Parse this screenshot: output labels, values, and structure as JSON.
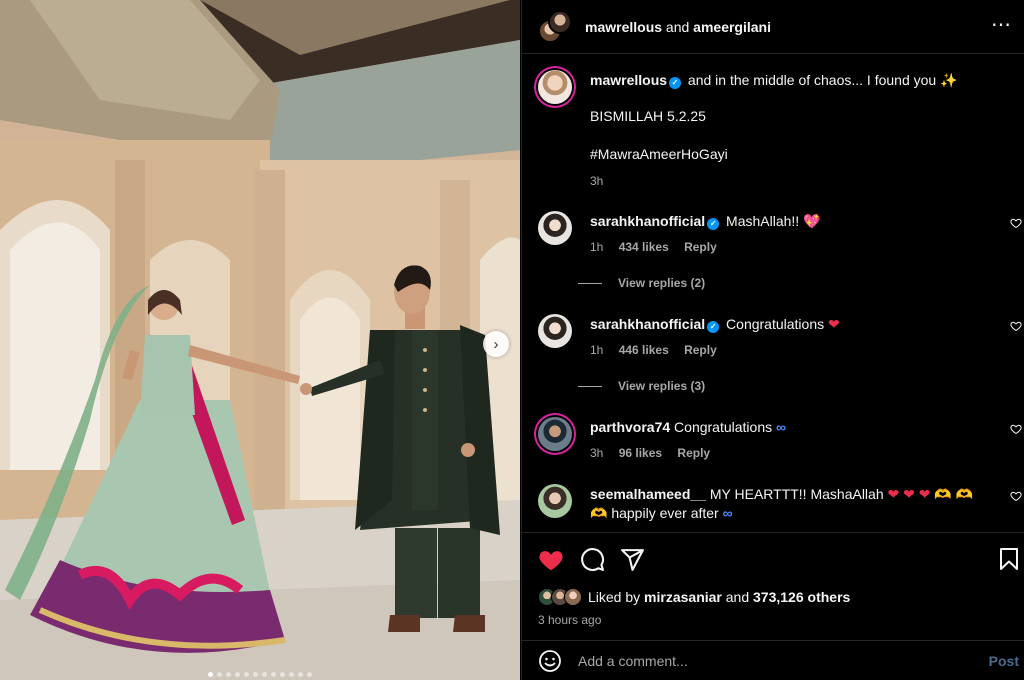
{
  "header": {
    "user1": "mawrellous",
    "and": "and",
    "user2": "ameergilani"
  },
  "caption": {
    "username": "mawrellous",
    "text": "and in the middle of chaos... I found you ✨",
    "line2": "BISMILLAH 5.2.25",
    "hashtag": "#MawraAmeerHoGayi",
    "time": "3h"
  },
  "comments": [
    {
      "username": "sarahkhanofficial",
      "verified": true,
      "text": "MashAllah!! ",
      "emoji": "💖",
      "time": "1h",
      "likes": "434 likes",
      "reply": "Reply",
      "view_replies": "View replies (2)"
    },
    {
      "username": "sarahkhanofficial",
      "verified": true,
      "text": "Congratulations ",
      "emoji": "❤",
      "time": "1h",
      "likes": "446 likes",
      "reply": "Reply",
      "view_replies": "View replies (3)"
    },
    {
      "username": "parthvora74",
      "verified": false,
      "text": "Congratulations ",
      "emoji": "∞",
      "time": "3h",
      "likes": "96 likes",
      "reply": "Reply"
    },
    {
      "username": "seemalhameed__",
      "verified": false,
      "text": "MY HEARTTT!! MashaAllah ",
      "emoji": "❤ ❤ ❤ 🫶 🫶",
      "text2_emoji": "🫶",
      "text2": " happily ever after ",
      "text2_end": "∞"
    }
  ],
  "likes": {
    "prefix": "Liked by",
    "user": "mirzasaniar",
    "and": "and",
    "count": "373,126 others"
  },
  "post_time": "3 hours ago",
  "add_comment": {
    "placeholder": "Add a comment...",
    "post_label": "Post"
  },
  "carousel": {
    "total_dots": 12,
    "active_index": 0
  },
  "colors": {
    "like_red": "#ed2d4c",
    "verified_blue": "#0095f6",
    "post_blue": "#4a6a8f"
  }
}
